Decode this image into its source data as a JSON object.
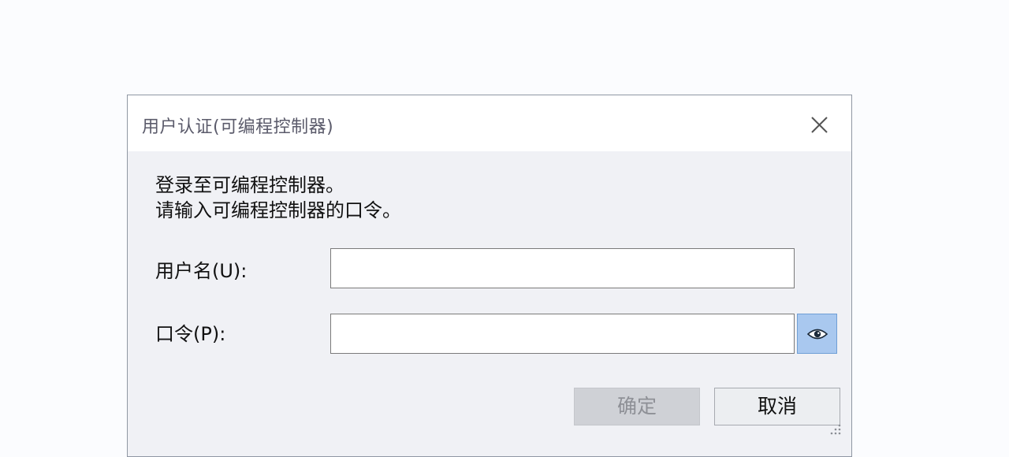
{
  "dialog": {
    "title": "用户认证(可编程控制器)",
    "message_line1": "登录至可编程控制器。",
    "message_line2": "请输入可编程控制器的口令。",
    "username_label": "用户名(U):",
    "username_value": "",
    "password_label": "口令(P):",
    "password_value": "",
    "ok_label": "确定",
    "cancel_label": "取消"
  },
  "icons": {
    "close": "close-icon",
    "show_password": "eye-icon",
    "resize": "resize-grip-icon"
  },
  "colors": {
    "background": "#fbfcfe",
    "dialog_body": "#f0f1f5",
    "eye_button": "#a9c8ef",
    "ok_disabled": "#cfd1d6"
  }
}
